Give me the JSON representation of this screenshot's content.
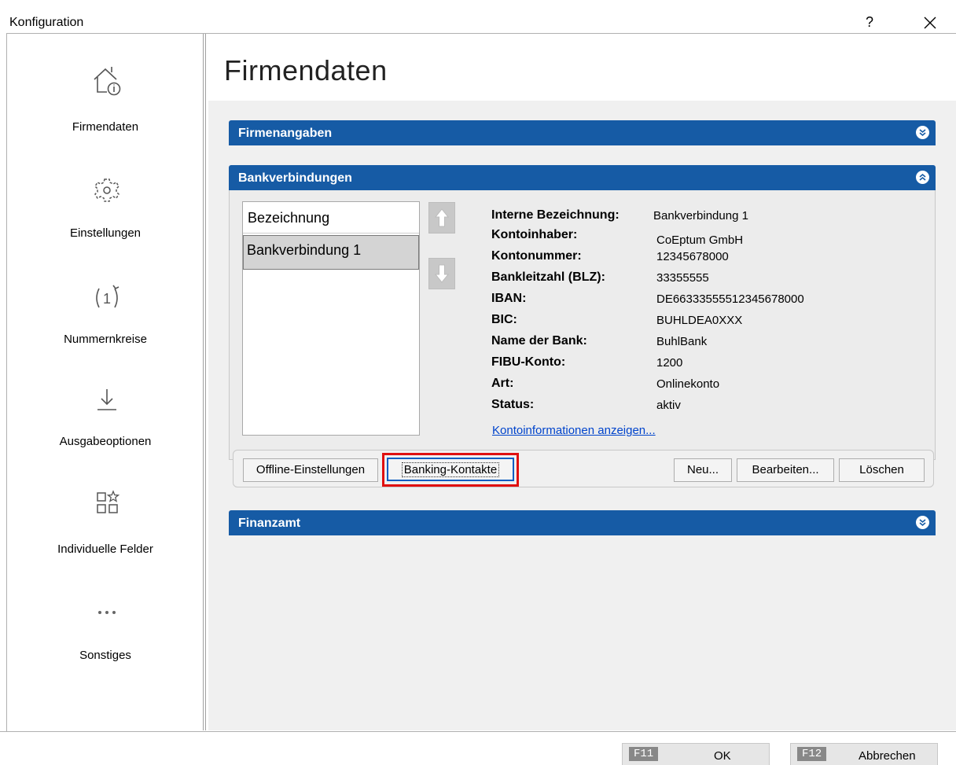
{
  "window": {
    "title": "Konfiguration",
    "help": "?"
  },
  "sidebar": {
    "items": [
      {
        "label": "Firmendaten",
        "icon": "house-info-icon"
      },
      {
        "label": "Einstellungen",
        "icon": "gear-icon"
      },
      {
        "label": "Nummernkreise",
        "icon": "number-cycle-icon"
      },
      {
        "label": "Ausgabeoptionen",
        "icon": "download-icon"
      },
      {
        "label": "Individuelle Felder",
        "icon": "grid-star-icon"
      },
      {
        "label": "Sonstiges",
        "icon": "more-icon"
      }
    ]
  },
  "main": {
    "title": "Firmendaten",
    "sections": {
      "firmenangaben": "Firmenangaben",
      "bankverbindungen": "Bankverbindungen",
      "finanzamt": "Finanzamt"
    },
    "list": {
      "header": "Bezeichnung",
      "rows": [
        "Bankverbindung 1"
      ]
    },
    "details": [
      {
        "key": "Interne Bezeichnung:",
        "value": "Bankverbindung 1"
      },
      {
        "key": "Kontoinhaber:",
        "value": "CoEptum GmbH"
      },
      {
        "key": "Kontonummer:",
        "value": "12345678000"
      },
      {
        "key": "Bankleitzahl (BLZ):",
        "value": "33355555"
      },
      {
        "key": "IBAN:",
        "value": "DE66333555512345678000"
      },
      {
        "key": "BIC:",
        "value": "BUHLDEA0XXX"
      },
      {
        "key": "Name der Bank:",
        "value": "BuhlBank"
      },
      {
        "key": "FIBU-Konto:",
        "value": "1200"
      },
      {
        "key": "Art:",
        "value": "Onlinekonto"
      },
      {
        "key": "Status:",
        "value": "aktiv"
      }
    ],
    "link": "Kontoinformationen anzeigen...",
    "buttons": {
      "offline": "Offline-Einstellungen",
      "banking": "Banking-Kontakte",
      "neu": "Neu...",
      "bearbeiten": "Bearbeiten...",
      "loeschen": "Löschen"
    }
  },
  "footer": {
    "ok_key": "F11",
    "ok_label": "OK",
    "cancel_key": "F12",
    "cancel_label": "Abbrechen"
  },
  "colors": {
    "accent": "#165ba5",
    "highlight": "#e01010",
    "link": "#0044cc"
  }
}
